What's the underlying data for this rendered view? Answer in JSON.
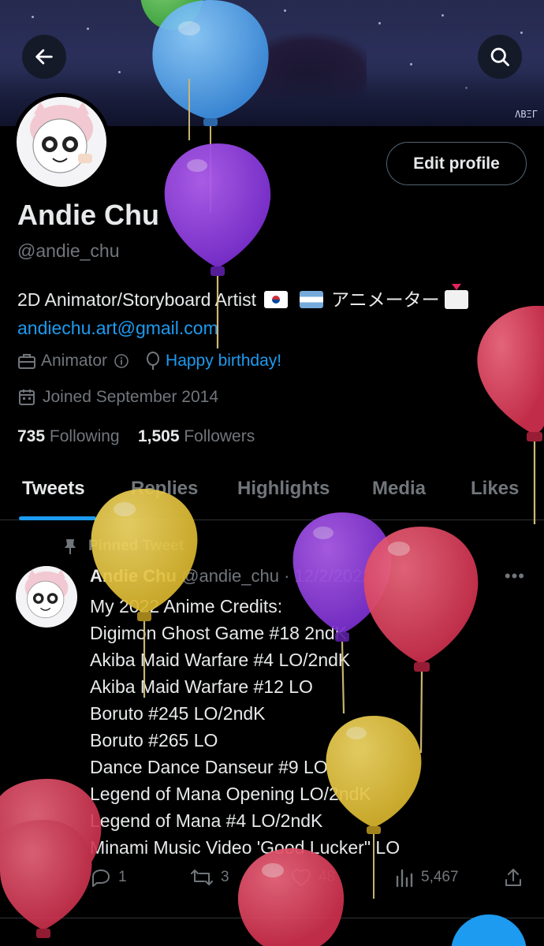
{
  "banner": {
    "signature": "ΛBΞΓ"
  },
  "profile": {
    "name": "Andie Chu",
    "handle": "@andie_chu",
    "edit_label": "Edit profile",
    "bio_text": "2D Animator/Storyboard Artist",
    "bio_jp": "アニメーター",
    "email": "andiechu.art@gmail.com",
    "category": "Animator",
    "birthday_link": "Happy birthday!",
    "joined": "Joined September 2014",
    "following_count": "735",
    "following_label": "Following",
    "followers_count": "1,505",
    "followers_label": "Followers"
  },
  "tabs": [
    "Tweets",
    "Replies",
    "Highlights",
    "Media",
    "Likes"
  ],
  "tweet": {
    "pinned_label": "Pinned Tweet",
    "author": "Andie Chu",
    "handle_date": "@andie_chu · 12/2/2022",
    "lines": [
      "My 2022 Anime Credits:",
      "Digimon Ghost Game #18 2ndK",
      "Akiba Maid Warfare #4 LO/2ndK",
      "Akiba Maid Warfare #12 LO",
      "Boruto #245 LO/2ndK",
      "Boruto #265 LO",
      "Dance Dance Danseur #9 LO",
      "Legend of Mana Opening LO/2ndK",
      "Legend of Mana #4 LO/2ndK",
      "Minami Music Video 'Good Lucker\" LO"
    ],
    "replies": "1",
    "retweets": "3",
    "likes": "48",
    "views": "5,467"
  },
  "icons": [
    "back-arrow-icon",
    "search-icon",
    "briefcase-icon",
    "info-icon",
    "balloon-icon",
    "calendar-icon",
    "pin-icon",
    "more-icon",
    "reply-icon",
    "retweet-icon",
    "like-icon",
    "views-icon",
    "share-icon"
  ],
  "colors": {
    "accent": "#1d9bf0",
    "muted": "#71767b",
    "text": "#e7e9ea",
    "background": "#000000"
  }
}
